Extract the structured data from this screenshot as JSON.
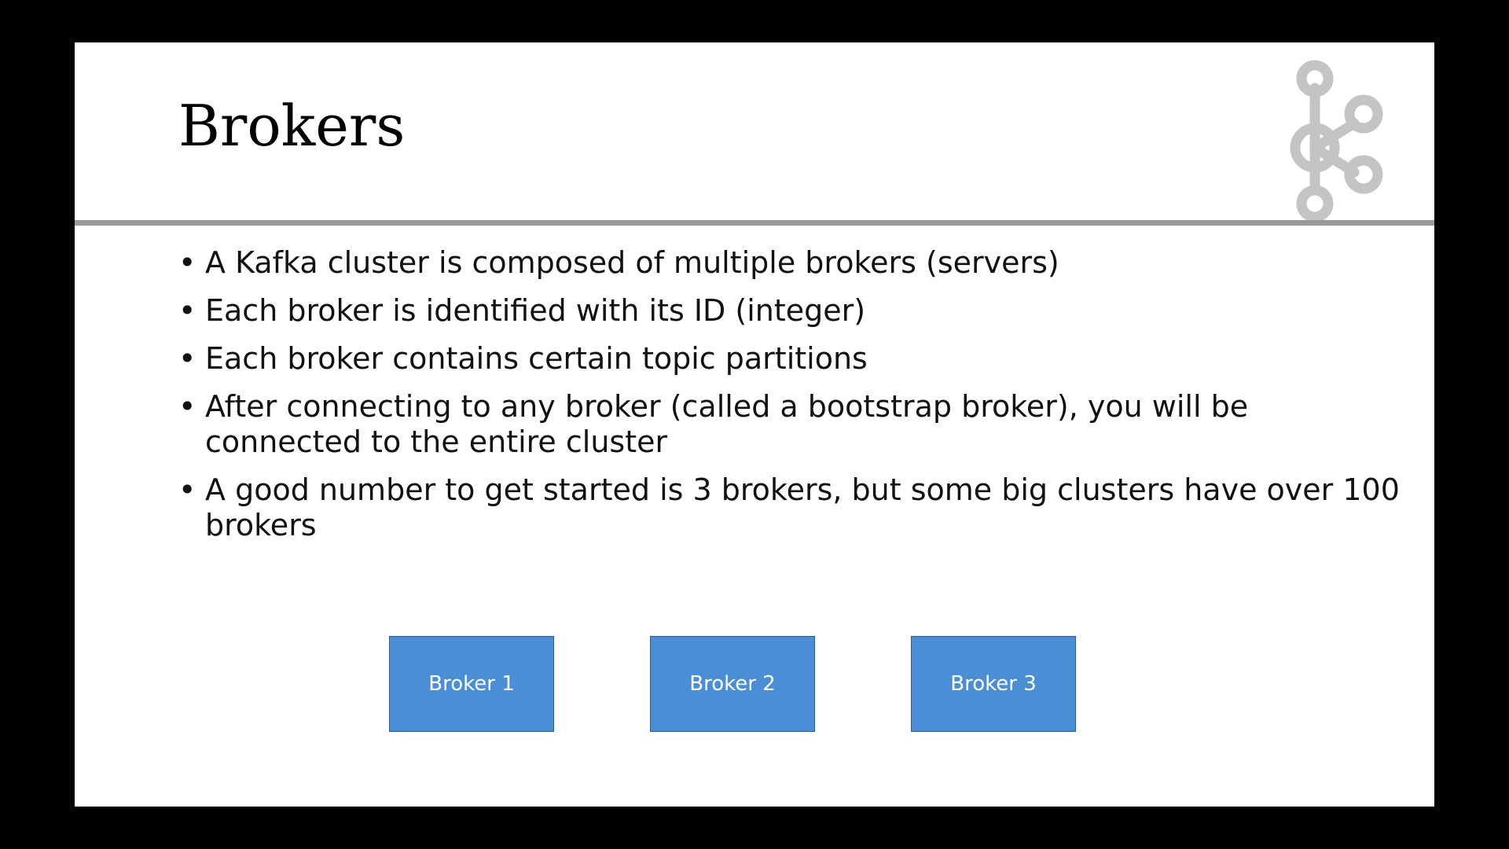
{
  "slide": {
    "title": "Brokers",
    "bullets": [
      "A Kafka cluster is composed of multiple brokers (servers)",
      "Each broker is identified with its ID (integer)",
      "Each broker contains certain topic partitions",
      "After connecting to any broker (called a bootstrap broker), you will be connected to the entire cluster",
      "A good number to get started is 3 brokers, but some big clusters have over 100 brokers"
    ],
    "bullet_glyph": "•",
    "brokers": [
      "Broker 1",
      "Broker 2",
      "Broker 3"
    ],
    "logo_icon": "kafka-logo-icon",
    "colors": {
      "broker_fill": "#4a8fd6",
      "broker_border": "#2e5f8f",
      "rule": "#9a9a9a",
      "logo": "#c4c4c4"
    }
  }
}
